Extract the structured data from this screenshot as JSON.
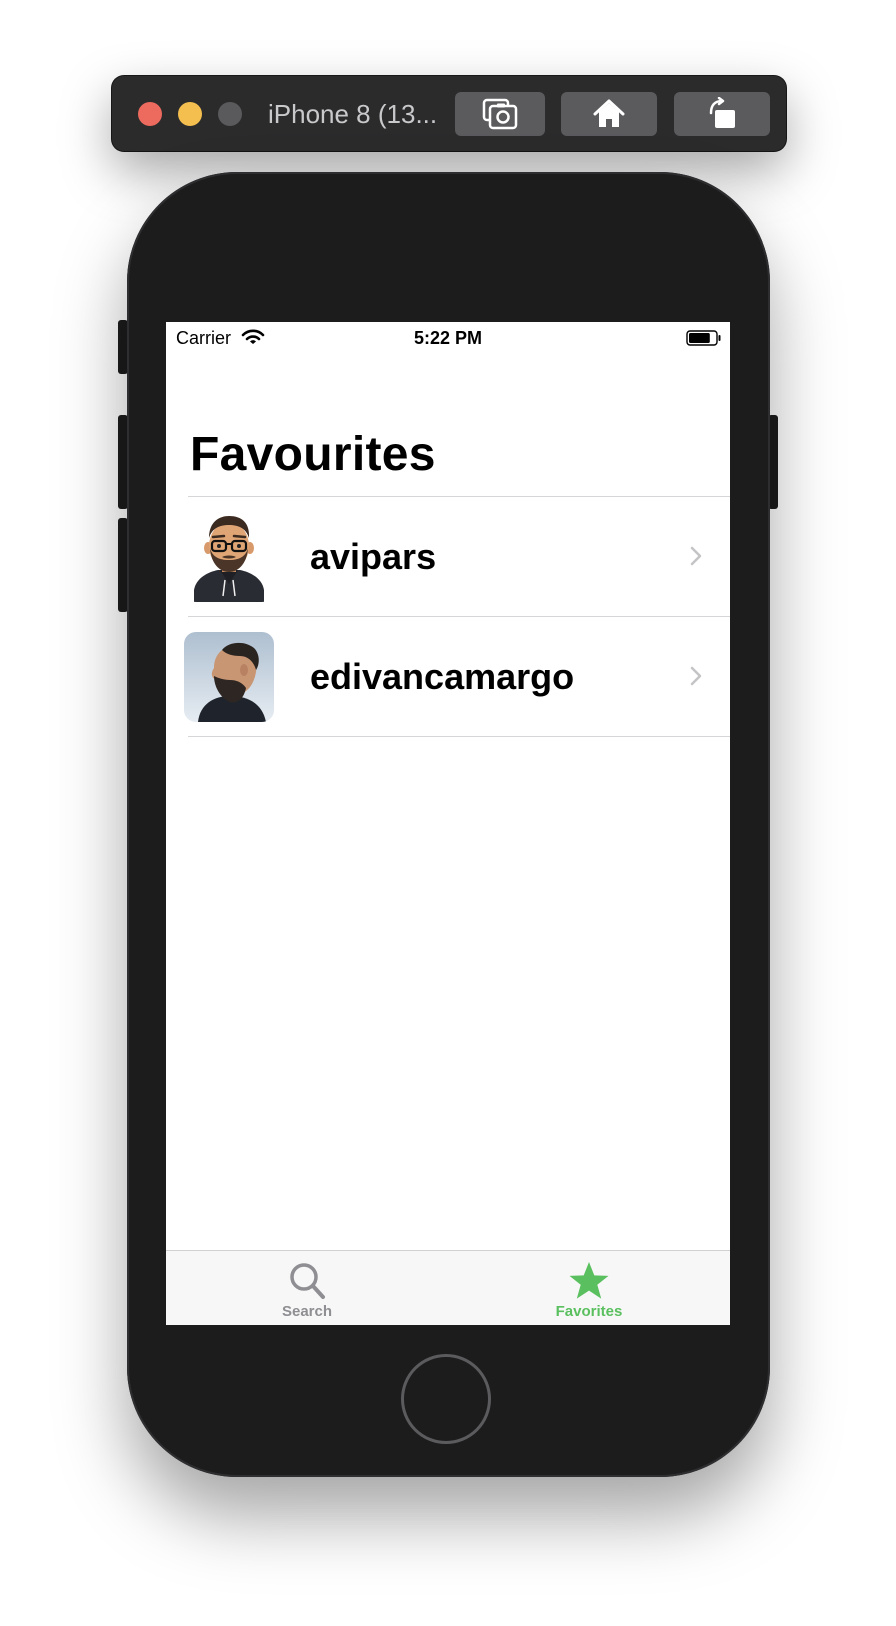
{
  "simulator": {
    "title": "iPhone 8 (13...",
    "buttons": [
      {
        "icon": "screenshot-icon"
      },
      {
        "icon": "home-icon"
      },
      {
        "icon": "rotate-icon"
      }
    ]
  },
  "status_bar": {
    "carrier": "Carrier",
    "time": "5:22 PM",
    "battery_level": 0.8
  },
  "screen": {
    "title": "Favourites",
    "favorites": [
      {
        "username": "avipars",
        "avatar": "memoji-avatar"
      },
      {
        "username": "edivancamargo",
        "avatar": "photo-avatar"
      }
    ]
  },
  "tab_bar": {
    "selected": "favorites",
    "accent_color": "#5ac05f",
    "inactive_color": "#8e8e93",
    "tabs": [
      {
        "label": "Search",
        "icon": "magnifier-icon"
      },
      {
        "label": "Favorites",
        "icon": "star-icon"
      }
    ]
  }
}
